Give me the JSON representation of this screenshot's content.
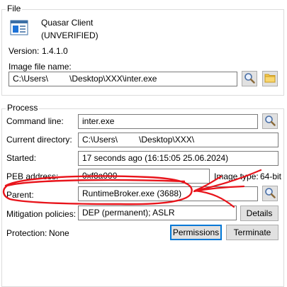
{
  "file": {
    "group_title": "File",
    "app_name": "Quasar Client",
    "verification": "(UNVERIFIED)",
    "version_label": "Version:",
    "version_value": "1.4.1.0",
    "image_label": "Image file name:",
    "image_path_part1": "C:\\Users\\",
    "image_path_part2": "\\Desktop\\XXX\\inter.exe"
  },
  "process": {
    "group_title": "Process",
    "command_line_label": "Command line:",
    "command_line_value": "inter.exe",
    "current_dir_label": "Current directory:",
    "current_dir_part1": "C:\\Users\\",
    "current_dir_part2": "\\Desktop\\XXX\\",
    "started_label": "Started:",
    "started_value": "17 seconds ago (16:15:05 25.06.2024)",
    "peb_label": "PEB address:",
    "peb_value": "0xf8a000",
    "image_type_label": "Image type:",
    "image_type_value": "64-bit",
    "parent_label": "Parent:",
    "parent_value": "RuntimeBroker.exe (3688)",
    "mitigation_label": "Mitigation policies:",
    "mitigation_value": "DEP (permanent); ASLR",
    "details_button": "Details",
    "protection_label": "Protection:",
    "protection_value": "None",
    "permissions_button": "Permissions",
    "terminate_button": "Terminate"
  },
  "annotation_color": "#e8141b"
}
